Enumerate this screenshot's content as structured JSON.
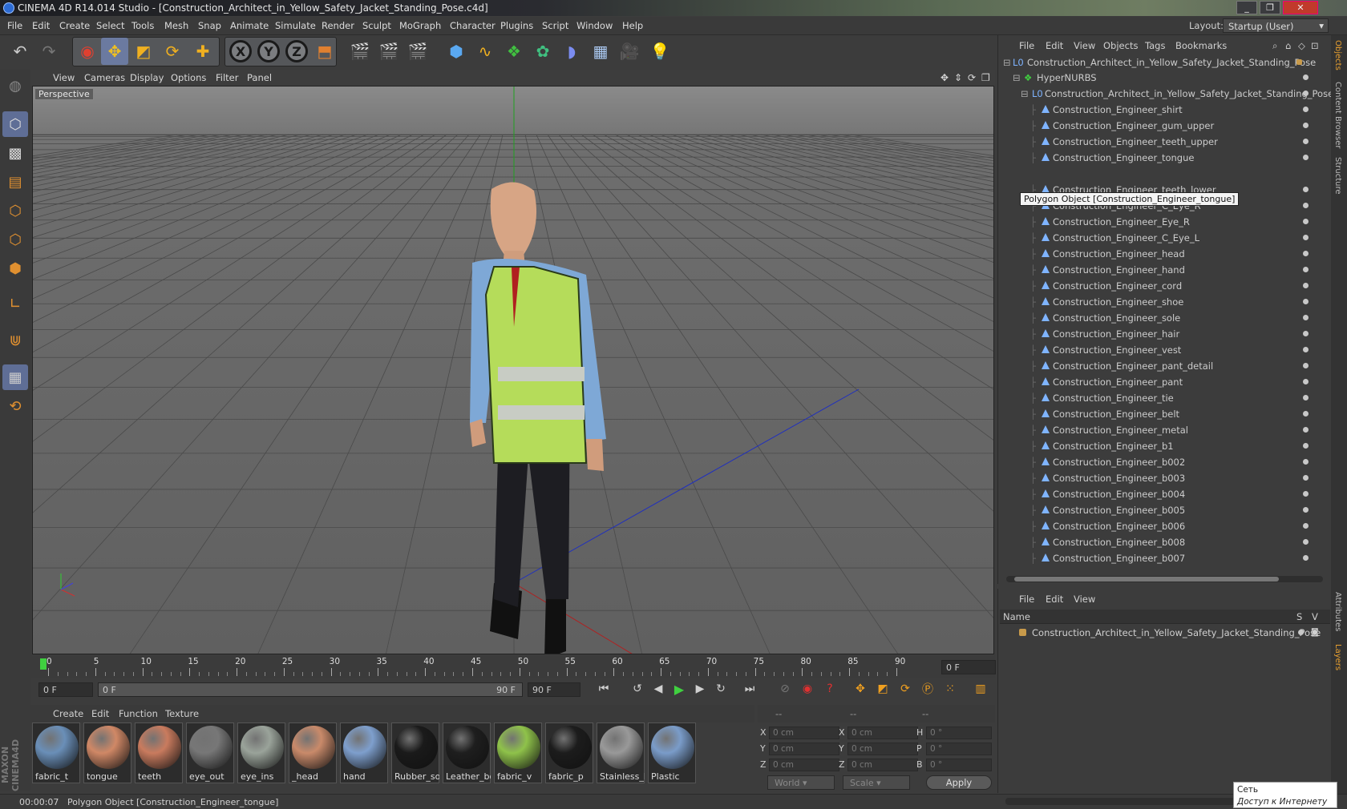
{
  "window": {
    "title": "CINEMA 4D R14.014 Studio - [Construction_Architect_in_Yellow_Safety_Jacket_Standing_Pose.c4d]"
  },
  "menu": [
    "File",
    "Edit",
    "Create",
    "Select",
    "Tools",
    "Mesh",
    "Snap",
    "Animate",
    "Simulate",
    "Render",
    "Sculpt",
    "MoGraph",
    "Character",
    "Plugins",
    "Script",
    "Window",
    "Help"
  ],
  "layout": {
    "label": "Layout:",
    "value": "Startup (User)"
  },
  "viewport": {
    "menu": [
      "View",
      "Cameras",
      "Display",
      "Options",
      "Filter",
      "Panel"
    ],
    "label": "Perspective"
  },
  "timeline": {
    "ticks": [
      "0",
      "5",
      "10",
      "15",
      "20",
      "25",
      "30",
      "35",
      "40",
      "45",
      "50",
      "55",
      "60",
      "65",
      "70",
      "75",
      "80",
      "85",
      "90"
    ],
    "frame_field": "0 F",
    "start": "0 F",
    "range_start": "0 F",
    "range_end": "90 F",
    "end": "90 F"
  },
  "materials": {
    "menu": [
      "Create",
      "Edit",
      "Function",
      "Texture"
    ],
    "items": [
      {
        "label": "fabric_t",
        "color": "#6a8fb8"
      },
      {
        "label": "tongue",
        "color": "#d08866"
      },
      {
        "label": "teeth",
        "color": "#c97b5e"
      },
      {
        "label": "eye_out",
        "color": "#777777"
      },
      {
        "label": "eye_ins",
        "color": "#9aa39a"
      },
      {
        "label": "_head",
        "color": "#c98a6a"
      },
      {
        "label": "hand",
        "color": "#7e9fcd"
      },
      {
        "label": "Rubber_so",
        "color": "#1a1a1a"
      },
      {
        "label": "Leather_bo",
        "color": "#1e1e1e"
      },
      {
        "label": "fabric_v",
        "color": "#8fc24a"
      },
      {
        "label": "fabric_p",
        "color": "#1c1c1c"
      },
      {
        "label": "Stainless_h",
        "color": "#999999"
      },
      {
        "label": "Plastic",
        "color": "#7a9cc9"
      }
    ]
  },
  "coords": {
    "head": [
      "--",
      "--",
      "--"
    ],
    "rows": [
      {
        "a": "X",
        "av": "0 cm",
        "b": "X",
        "bv": "0 cm",
        "c": "H",
        "cv": "0 °"
      },
      {
        "a": "Y",
        "av": "0 cm",
        "b": "Y",
        "bv": "0 cm",
        "c": "P",
        "cv": "0 °"
      },
      {
        "a": "Z",
        "av": "0 cm",
        "b": "Z",
        "bv": "0 cm",
        "c": "B",
        "cv": "0 °"
      }
    ],
    "world": "World",
    "scale": "Scale",
    "apply": "Apply"
  },
  "status": {
    "time": "00:00:07",
    "message": "Polygon Object [Construction_Engineer_tongue]"
  },
  "objects": {
    "menu": [
      "File",
      "Edit",
      "View",
      "Objects",
      "Tags",
      "Bookmarks"
    ],
    "root": "Construction_Architect_in_Yellow_Safety_Jacket_Standing_Pose",
    "hypernurbs": "HyperNURBS",
    "group": "Construction_Architect_in_Yellow_Safety_Jacket_Standing_Pose",
    "items": [
      "Construction_Engineer_shirt",
      "Construction_Engineer_gum_upper",
      "Construction_Engineer_teeth_upper",
      "Construction_Engineer_tongue",
      "",
      "Construction_Engineer_teeth_lower",
      "Construction_Engineer_C_Eye_R",
      "Construction_Engineer_Eye_R",
      "Construction_Engineer_C_Eye_L",
      "Construction_Engineer_head",
      "Construction_Engineer_hand",
      "Construction_Engineer_cord",
      "Construction_Engineer_shoe",
      "Construction_Engineer_sole",
      "Construction_Engineer_hair",
      "Construction_Engineer_vest",
      "Construction_Engineer_pant_detail",
      "Construction_Engineer_pant",
      "Construction_Engineer_tie",
      "Construction_Engineer_belt",
      "Construction_Engineer_metal",
      "Construction_Engineer_b1",
      "Construction_Engineer_b002",
      "Construction_Engineer_b003",
      "Construction_Engineer_b004",
      "Construction_Engineer_b005",
      "Construction_Engineer_b006",
      "Construction_Engineer_b008",
      "Construction_Engineer_b007"
    ],
    "tooltip": "Polygon Object [Construction_Engineer_tongue]"
  },
  "sidetabs": [
    "Objects",
    "Content Browser",
    "Structure",
    "Attributes",
    "Layers"
  ],
  "layers": {
    "menu": [
      "File",
      "Edit",
      "View"
    ],
    "col_name": "Name",
    "col_s": "S",
    "col_v": "V",
    "row": "Construction_Architect_in_Yellow_Safety_Jacket_Standing_Pose"
  },
  "network": {
    "line1": "Сеть",
    "line2": "Доступ к Интернету"
  }
}
